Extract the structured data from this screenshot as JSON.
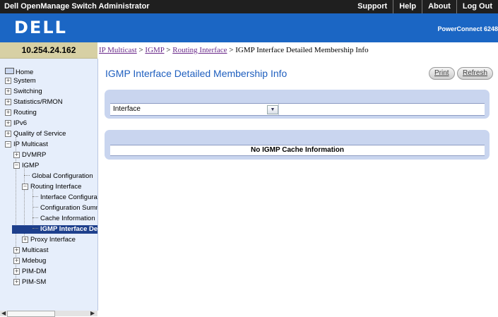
{
  "header": {
    "app_title": "Dell OpenManage Switch Administrator",
    "links": [
      "Support",
      "Help",
      "About",
      "Log Out"
    ],
    "logo": "DELL",
    "product": "PowerConnect 6248"
  },
  "ip_address": "10.254.24.162",
  "breadcrumb": {
    "links": [
      "IP Multicast",
      "IGMP",
      "Routing Interface"
    ],
    "separator": " > ",
    "current": "IGMP Interface Detailed Membership Info"
  },
  "sidebar": {
    "home": "Home",
    "items": {
      "system": "System",
      "switching": "Switching",
      "statistics": "Statistics/RMON",
      "routing": "Routing",
      "ipv6": "IPv6",
      "qos": "Quality of Service",
      "ip_multicast": "IP Multicast",
      "dvmrp": "DVMRP",
      "igmp": "IGMP",
      "global_config": "Global Configuration",
      "routing_interface": "Routing Interface",
      "interface_config": "Interface Configuration",
      "config_summary": "Configuration Summary",
      "cache_info": "Cache Information",
      "igmp_interface_detail": "IGMP Interface Detailed Membership Info",
      "proxy_interface": "Proxy Interface",
      "multicast": "Multicast",
      "mdebug": "Mdebug",
      "pim_dm": "PIM-DM",
      "pim_sm": "PIM-SM"
    }
  },
  "main": {
    "title": "IGMP Interface Detailed Membership Info",
    "buttons": {
      "print": "Print",
      "refresh": "Refresh"
    },
    "interface_label": "Interface",
    "interface_value": "",
    "no_cache_message": "No IGMP Cache Information"
  },
  "colors": {
    "brand_blue": "#1b66c4",
    "title_blue": "#1f5fbf",
    "panel_blue": "#c9d5ef",
    "sidebar_bg": "#e6eefb",
    "selected_bg": "#1d3f8c",
    "ip_box_bg": "#d7d0a4",
    "link_purple": "#6a2a8a"
  }
}
